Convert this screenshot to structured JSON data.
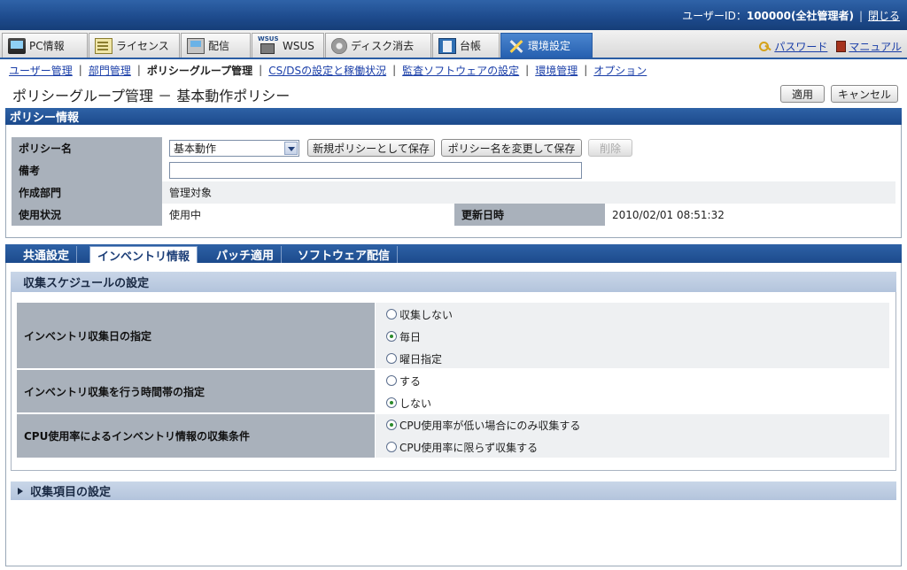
{
  "header": {
    "user_label": "ユーザーID：",
    "user_id": "100000",
    "user_role": "(全社管理者)",
    "logout": "閉じる"
  },
  "nav": {
    "tabs": [
      {
        "label": "PC情報",
        "icon": "pc-icon"
      },
      {
        "label": "ライセンス",
        "icon": "license-icon"
      },
      {
        "label": "配信",
        "icon": "distribution-icon"
      },
      {
        "label": "WSUS",
        "icon": "wsus-icon"
      },
      {
        "label": "ディスク消去",
        "icon": "disk-erase-icon"
      },
      {
        "label": "台帳",
        "icon": "ledger-icon"
      },
      {
        "label": "環境設定",
        "icon": "tools-icon",
        "active": true
      }
    ],
    "password_link": "パスワード",
    "manual_link": "マニュアル"
  },
  "submenu": {
    "items": [
      "ユーザー管理",
      "部門管理",
      "ポリシーグループ管理",
      "CS/DSの設定と稼働状況",
      "監査ソフトウェアの設定",
      "環境管理",
      "オプション"
    ],
    "current_index": 2
  },
  "page": {
    "title": "ポリシーグループ管理 － 基本動作ポリシー",
    "apply_button": "適用",
    "cancel_button": "キャンセル"
  },
  "policy_info": {
    "section_title": "ポリシー情報",
    "policy_name_label": "ポリシー名",
    "policy_name_value": "基本動作",
    "save_new_button": "新規ポリシーとして保存",
    "rename_save_button": "ポリシー名を変更して保存",
    "delete_button": "削除",
    "remarks_label": "備考",
    "remarks_value": "",
    "dept_label": "作成部門",
    "dept_value": "管理対象",
    "status_label": "使用状況",
    "status_value": "使用中",
    "updated_label": "更新日時",
    "updated_value": "2010/02/01 08:51:32"
  },
  "subtabs": [
    "共通設定",
    "インベントリ情報",
    "パッチ適用",
    "ソフトウェア配信"
  ],
  "subtab_active": 1,
  "schedule": {
    "title": "収集スケジュールの設定",
    "rows": [
      {
        "label": "インベントリ収集日の指定",
        "options": [
          "収集しない",
          "毎日",
          "曜日指定"
        ],
        "selected": 1
      },
      {
        "label": "インベントリ収集を行う時間帯の指定",
        "options": [
          "する",
          "しない"
        ],
        "selected": 1
      },
      {
        "label": "CPU使用率によるインベントリ情報の収集条件",
        "options": [
          "CPU使用率が低い場合にのみ収集する",
          "CPU使用率に限らず収集する"
        ],
        "selected": 0
      }
    ]
  },
  "items_section": {
    "title": "収集項目の設定"
  }
}
